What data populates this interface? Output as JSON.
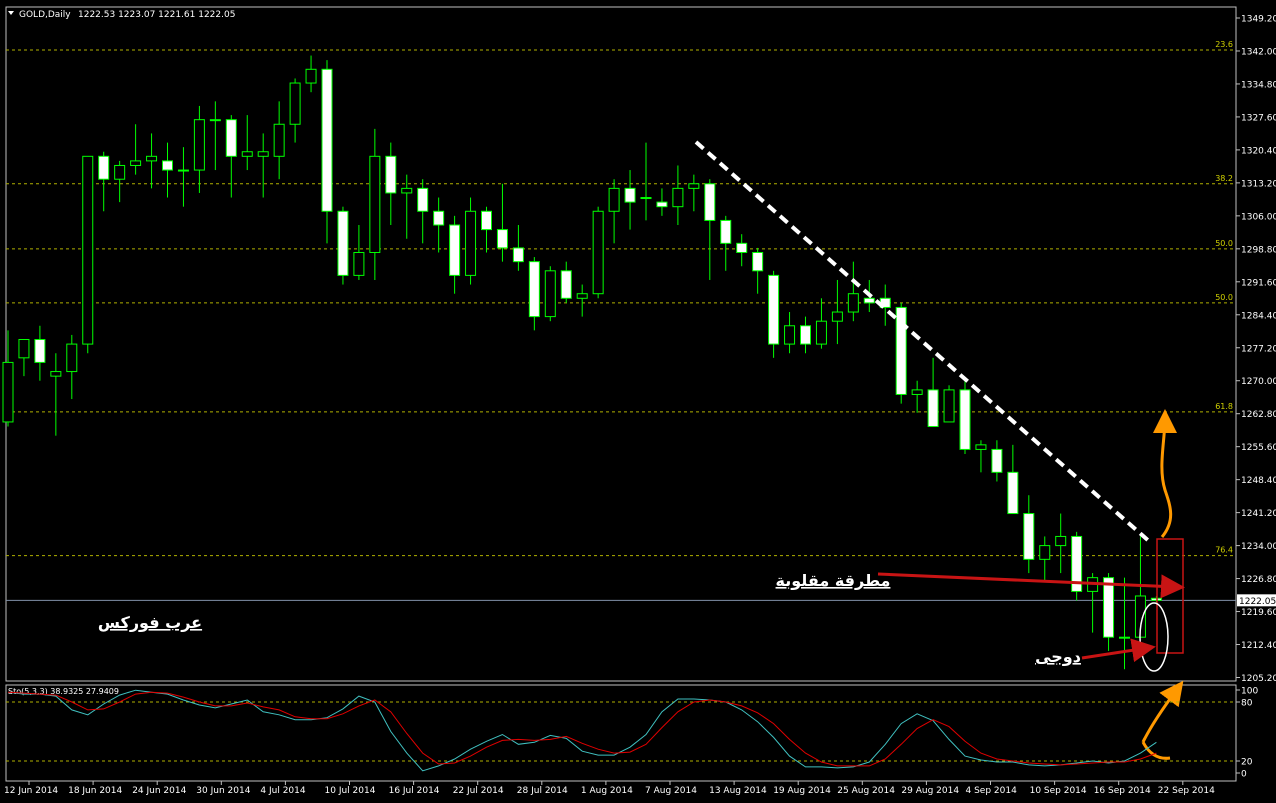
{
  "header": {
    "symbol": "GOLD,Daily",
    "ohlc": "1222.53 1223.07 1221.61 1222.05"
  },
  "stoch_header": "Sto(5,3,3) 38.9325 27.9409",
  "annotations": {
    "watermark": "عرب فوركس",
    "hammer_label": "مطرقة مقلوبة",
    "doji_label": "دوجى"
  },
  "colors": {
    "background": "#000000",
    "bull_body": "#000000",
    "bear_body": "#ffffff",
    "candle_outline": "#00ff00",
    "grid": "#b0b000",
    "axis": "#c0c0c0",
    "stoch_main": "#40c0c0",
    "stoch_signal": "#e00000",
    "arrow_red": "#c81414",
    "arrow_orange": "#ff9900",
    "trendline": "#ffffff"
  },
  "chart_data": [
    {
      "type": "candlestick",
      "title": "GOLD,Daily",
      "ylim": [
        1205.2,
        1349.2
      ],
      "y_ticks": [
        "1349.20",
        "1342.00",
        "1334.80",
        "1327.60",
        "1320.40",
        "1313.20",
        "1306.00",
        "1298.80",
        "1291.60",
        "1284.40",
        "1277.20",
        "1270.00",
        "1262.80",
        "1255.60",
        "1248.40",
        "1241.20",
        "1234.00",
        "1226.80",
        "1219.60",
        "1212.40",
        "1205.20"
      ],
      "x_labels": [
        "12 Jun 2014",
        "18 Jun 2014",
        "24 Jun 2014",
        "30 Jun 2014",
        "4 Jul 2014",
        "10 Jul 2014",
        "16 Jul 2014",
        "22 Jul 2014",
        "28 Jul 2014",
        "1 Aug 2014",
        "7 Aug 2014",
        "13 Aug 2014",
        "19 Aug 2014",
        "25 Aug 2014",
        "29 Aug 2014",
        "4 Sep 2014",
        "10 Sep 2014",
        "16 Sep 2014",
        "22 Sep 2014"
      ],
      "fib_levels": [
        {
          "label": "23.6",
          "value": 1342.2
        },
        {
          "label": "38.2",
          "value": 1313.0
        },
        {
          "label": "50.0",
          "value": 1298.8
        },
        {
          "label": "50.0",
          "value": 1287.0
        },
        {
          "label": "61.8",
          "value": 1263.2
        },
        {
          "label": "76.4",
          "value": 1231.8
        }
      ],
      "current_price": 1222.05,
      "candles": [
        {
          "o": 1261,
          "h": 1281,
          "l": 1260,
          "c": 1274
        },
        {
          "o": 1275,
          "h": 1279,
          "l": 1271,
          "c": 1279
        },
        {
          "o": 1279,
          "h": 1282,
          "l": 1270,
          "c": 1274
        },
        {
          "o": 1271,
          "h": 1276,
          "l": 1258,
          "c": 1272
        },
        {
          "o": 1272,
          "h": 1280,
          "l": 1266,
          "c": 1278
        },
        {
          "o": 1278,
          "h": 1319,
          "l": 1276,
          "c": 1319
        },
        {
          "o": 1319,
          "h": 1320,
          "l": 1307,
          "c": 1314
        },
        {
          "o": 1314,
          "h": 1318,
          "l": 1309,
          "c": 1317
        },
        {
          "o": 1317,
          "h": 1326,
          "l": 1315,
          "c": 1318
        },
        {
          "o": 1318,
          "h": 1324,
          "l": 1312,
          "c": 1319
        },
        {
          "o": 1318,
          "h": 1322,
          "l": 1310,
          "c": 1316
        },
        {
          "o": 1316,
          "h": 1321,
          "l": 1308,
          "c": 1316
        },
        {
          "o": 1316,
          "h": 1330,
          "l": 1311,
          "c": 1327
        },
        {
          "o": 1327,
          "h": 1331,
          "l": 1316,
          "c": 1327
        },
        {
          "o": 1327,
          "h": 1328,
          "l": 1310,
          "c": 1319
        },
        {
          "o": 1319,
          "h": 1328,
          "l": 1316,
          "c": 1320
        },
        {
          "o": 1319,
          "h": 1324,
          "l": 1310,
          "c": 1320
        },
        {
          "o": 1319,
          "h": 1331,
          "l": 1314,
          "c": 1326
        },
        {
          "o": 1326,
          "h": 1336,
          "l": 1322,
          "c": 1335
        },
        {
          "o": 1335,
          "h": 1341,
          "l": 1333,
          "c": 1338
        },
        {
          "o": 1338,
          "h": 1340,
          "l": 1300,
          "c": 1307
        },
        {
          "o": 1307,
          "h": 1308,
          "l": 1291,
          "c": 1293
        },
        {
          "o": 1293,
          "h": 1304,
          "l": 1292,
          "c": 1298
        },
        {
          "o": 1298,
          "h": 1325,
          "l": 1292,
          "c": 1319
        },
        {
          "o": 1319,
          "h": 1322,
          "l": 1304,
          "c": 1311
        },
        {
          "o": 1311,
          "h": 1315,
          "l": 1301,
          "c": 1312
        },
        {
          "o": 1312,
          "h": 1314,
          "l": 1300,
          "c": 1307
        },
        {
          "o": 1307,
          "h": 1310,
          "l": 1298,
          "c": 1304
        },
        {
          "o": 1304,
          "h": 1306,
          "l": 1289,
          "c": 1293
        },
        {
          "o": 1293,
          "h": 1310,
          "l": 1291,
          "c": 1307
        },
        {
          "o": 1307,
          "h": 1308,
          "l": 1298,
          "c": 1303
        },
        {
          "o": 1303,
          "h": 1313,
          "l": 1296,
          "c": 1299
        },
        {
          "o": 1299,
          "h": 1304,
          "l": 1294,
          "c": 1296
        },
        {
          "o": 1296,
          "h": 1297,
          "l": 1281,
          "c": 1284
        },
        {
          "o": 1284,
          "h": 1295,
          "l": 1283,
          "c": 1294
        },
        {
          "o": 1294,
          "h": 1296,
          "l": 1287,
          "c": 1288
        },
        {
          "o": 1288,
          "h": 1291,
          "l": 1284,
          "c": 1289
        },
        {
          "o": 1289,
          "h": 1308,
          "l": 1288,
          "c": 1307
        },
        {
          "o": 1307,
          "h": 1314,
          "l": 1300,
          "c": 1312
        },
        {
          "o": 1312,
          "h": 1316,
          "l": 1303,
          "c": 1309
        },
        {
          "o": 1310,
          "h": 1322,
          "l": 1305,
          "c": 1310
        },
        {
          "o": 1309,
          "h": 1312,
          "l": 1306,
          "c": 1308
        },
        {
          "o": 1308,
          "h": 1317,
          "l": 1304,
          "c": 1312
        },
        {
          "o": 1312,
          "h": 1315,
          "l": 1307,
          "c": 1313
        },
        {
          "o": 1313,
          "h": 1314,
          "l": 1292,
          "c": 1305
        },
        {
          "o": 1305,
          "h": 1306,
          "l": 1294,
          "c": 1300
        },
        {
          "o": 1300,
          "h": 1302,
          "l": 1295,
          "c": 1298
        },
        {
          "o": 1298,
          "h": 1299,
          "l": 1289,
          "c": 1294
        },
        {
          "o": 1293,
          "h": 1294,
          "l": 1275,
          "c": 1278
        },
        {
          "o": 1278,
          "h": 1285,
          "l": 1276,
          "c": 1282
        },
        {
          "o": 1282,
          "h": 1284,
          "l": 1276,
          "c": 1278
        },
        {
          "o": 1278,
          "h": 1288,
          "l": 1277,
          "c": 1283
        },
        {
          "o": 1283,
          "h": 1292,
          "l": 1278,
          "c": 1285
        },
        {
          "o": 1285,
          "h": 1296,
          "l": 1283,
          "c": 1289
        },
        {
          "o": 1288,
          "h": 1292,
          "l": 1285,
          "c": 1287
        },
        {
          "o": 1288,
          "h": 1291,
          "l": 1282,
          "c": 1286
        },
        {
          "o": 1286,
          "h": 1287,
          "l": 1265,
          "c": 1267
        },
        {
          "o": 1267,
          "h": 1270,
          "l": 1263,
          "c": 1268
        },
        {
          "o": 1268,
          "h": 1275,
          "l": 1260,
          "c": 1260
        },
        {
          "o": 1261,
          "h": 1269,
          "l": 1261,
          "c": 1268
        },
        {
          "o": 1268,
          "h": 1270,
          "l": 1254,
          "c": 1255
        },
        {
          "o": 1255,
          "h": 1257,
          "l": 1250,
          "c": 1256
        },
        {
          "o": 1255,
          "h": 1257,
          "l": 1248,
          "c": 1250
        },
        {
          "o": 1250,
          "h": 1256,
          "l": 1244,
          "c": 1241
        },
        {
          "o": 1241,
          "h": 1245,
          "l": 1228,
          "c": 1231
        },
        {
          "o": 1231,
          "h": 1236,
          "l": 1226,
          "c": 1234
        },
        {
          "o": 1234,
          "h": 1241,
          "l": 1228,
          "c": 1236
        },
        {
          "o": 1236,
          "h": 1237,
          "l": 1222,
          "c": 1224
        },
        {
          "o": 1224,
          "h": 1228,
          "l": 1215,
          "c": 1227
        },
        {
          "o": 1227,
          "h": 1228,
          "l": 1211,
          "c": 1214
        },
        {
          "o": 1214,
          "h": 1227,
          "l": 1207,
          "c": 1214
        },
        {
          "o": 1214,
          "h": 1236,
          "l": 1214,
          "c": 1223
        },
        {
          "o": 1222.5,
          "h": 1223,
          "l": 1221.6,
          "c": 1222.05
        }
      ]
    },
    {
      "type": "line",
      "title": "Sto(5,3,3) 38.9325 27.9409",
      "ylim": [
        0,
        100
      ],
      "y_ticks": [
        "100",
        "80",
        "20",
        "0"
      ],
      "levels": [
        80,
        20
      ],
      "series": [
        {
          "name": "main",
          "values": [
            90,
            88,
            88,
            86,
            72,
            67,
            78,
            87,
            92,
            90,
            88,
            82,
            77,
            74,
            78,
            82,
            70,
            67,
            62,
            62,
            64,
            73,
            86,
            80,
            50,
            28,
            10,
            15,
            22,
            32,
            40,
            47,
            37,
            39,
            46,
            43,
            30,
            26,
            26,
            34,
            47,
            70,
            83,
            83,
            82,
            80,
            72,
            60,
            44,
            25,
            14,
            14,
            13,
            14,
            19,
            37,
            58,
            68,
            61,
            42,
            25,
            21,
            19,
            19,
            16,
            15,
            16,
            18,
            20,
            18,
            20,
            28,
            39
          ]
        },
        {
          "name": "signal",
          "values": [
            90,
            89,
            88,
            87,
            80,
            72,
            73,
            80,
            88,
            90,
            89,
            85,
            80,
            76,
            76,
            79,
            75,
            72,
            65,
            63,
            63,
            68,
            76,
            82,
            70,
            48,
            28,
            17,
            18,
            25,
            34,
            41,
            42,
            41,
            42,
            45,
            38,
            32,
            28,
            29,
            37,
            54,
            70,
            80,
            82,
            80,
            76,
            69,
            58,
            42,
            28,
            19,
            15,
            15,
            15,
            22,
            37,
            53,
            62,
            55,
            40,
            28,
            22,
            20,
            18,
            17,
            16,
            17,
            18,
            19,
            19,
            22,
            28
          ]
        }
      ]
    }
  ]
}
